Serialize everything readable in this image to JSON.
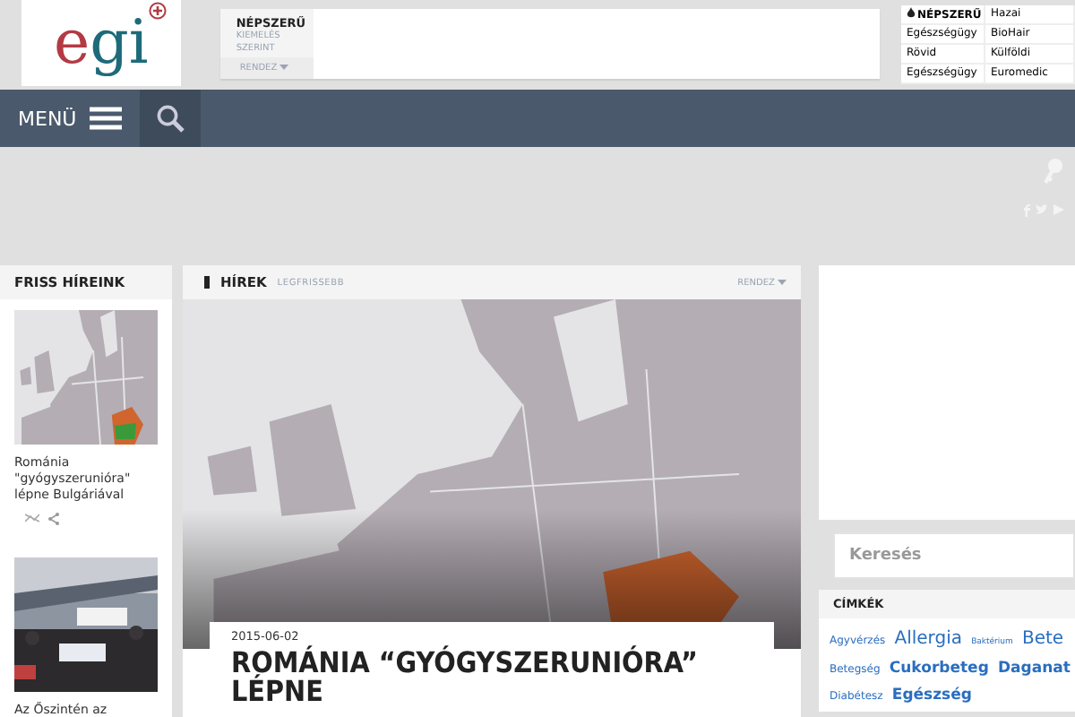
{
  "logo": {
    "first": "e",
    "rest": "gi"
  },
  "popular": {
    "title": "NÉPSZERŰ",
    "subtitle": "KIEMELÉS SZERINT",
    "sort": "RENDEZ"
  },
  "popular_table": [
    {
      "kind": "heading",
      "category": "NÉPSZERŰ",
      "source": "Hazai"
    },
    {
      "kind": "row",
      "category": "Egészségügy",
      "source": "BioHair"
    },
    {
      "kind": "row",
      "category": "Rövid",
      "source": "Külföldi"
    },
    {
      "kind": "row",
      "category": "Egészségügy",
      "source": "Euromedic"
    }
  ],
  "nav": {
    "menu": "MENÜ"
  },
  "sidebar": {
    "title": "FRISS HÍREINK",
    "items": [
      {
        "title": "Románia \"gyógyszerunióra\" lépne Bulgáriával",
        "actions": true
      },
      {
        "title": "Az Őszintén az",
        "actions": false
      }
    ]
  },
  "main": {
    "title": "HÍREK",
    "subtitle": "LEGFRISSEBB",
    "sort": "RENDEZ",
    "article": {
      "date": "2015-06-02",
      "headline": "ROMÁNIA “GYÓGYSZERUNIÓRA” LÉPNE"
    }
  },
  "right": {
    "search": {
      "placeholder": "Keresés"
    },
    "tags_title": "CÍMKÉK",
    "tags": [
      {
        "text": "Agyvérzés",
        "kind": "small"
      },
      {
        "text": "Allergia",
        "kind": "large"
      },
      {
        "text": "Baktérium",
        "kind": "tiny"
      },
      {
        "text": "Bete",
        "kind": "large"
      },
      {
        "text": "Betegség",
        "kind": "small"
      },
      {
        "text": "Cukorbeteg",
        "kind": "medium"
      },
      {
        "text": "Daganat",
        "kind": "medium"
      },
      {
        "text": "Diabétesz",
        "kind": "small"
      },
      {
        "text": "Egészség",
        "kind": "medium"
      }
    ]
  }
}
